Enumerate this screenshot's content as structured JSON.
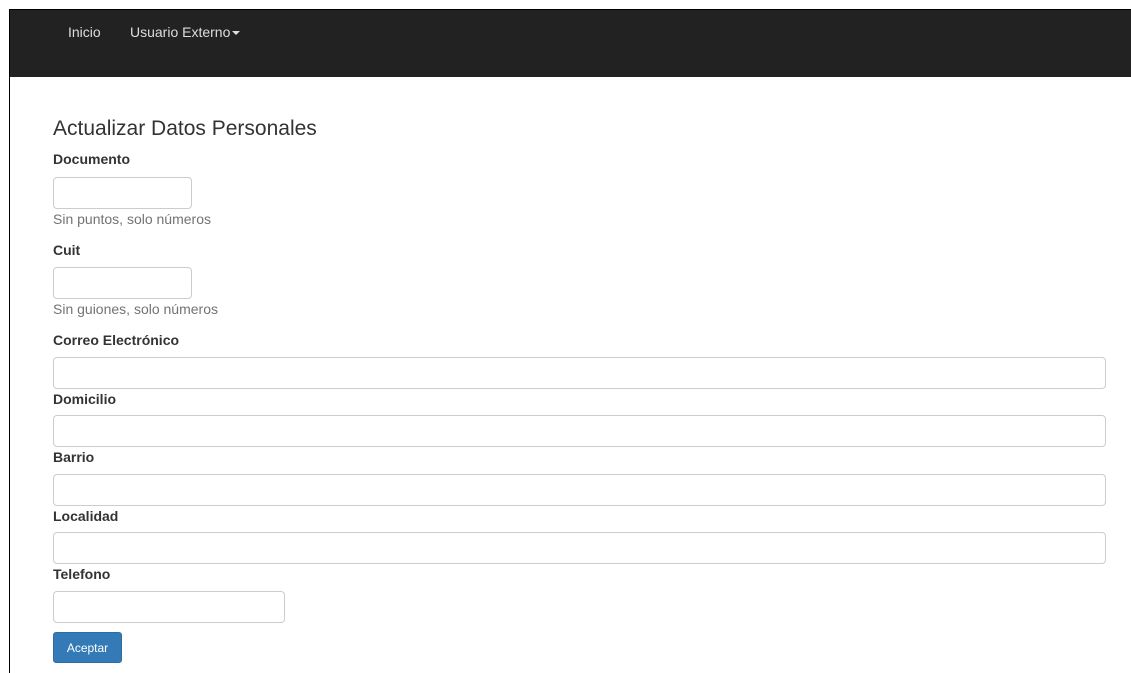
{
  "navbar": {
    "items": [
      {
        "label": "Inicio"
      },
      {
        "label": "Usuario Externo"
      }
    ]
  },
  "form": {
    "title": "Actualizar Datos Personales",
    "fields": {
      "documento": {
        "label": "Documento",
        "value": "",
        "help": "Sin puntos, solo números"
      },
      "cuit": {
        "label": "Cuit",
        "value": "",
        "help": "Sin guiones, solo números"
      },
      "correo": {
        "label": "Correo Electrónico",
        "value": ""
      },
      "domicilio": {
        "label": "Domicilio",
        "value": ""
      },
      "barrio": {
        "label": "Barrio",
        "value": ""
      },
      "localidad": {
        "label": "Localidad",
        "value": ""
      },
      "telefono": {
        "label": "Telefono",
        "value": ""
      }
    },
    "submit_label": "Aceptar"
  },
  "colors": {
    "navbar_bg": "#222222",
    "primary": "#337ab7"
  }
}
